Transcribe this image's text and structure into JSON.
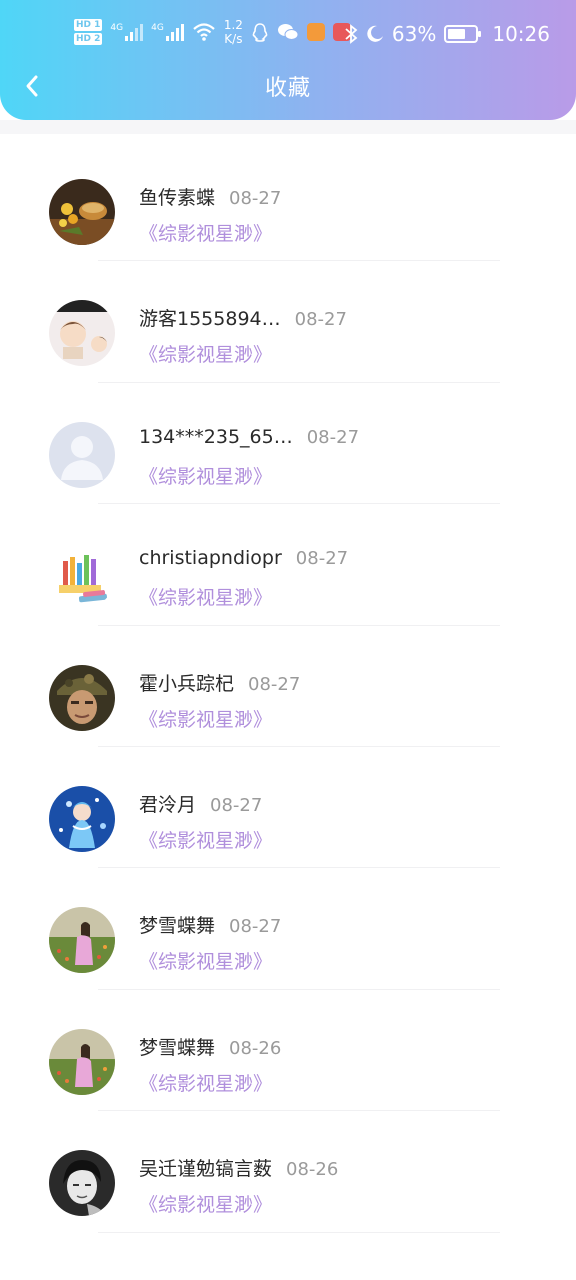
{
  "status_bar": {
    "hd1": "HD",
    "hd1_num": "1",
    "hd2": "HD",
    "hd2_num": "2",
    "net1": "4G",
    "net2": "4G",
    "speed_value": "1.2",
    "speed_unit": "K/s",
    "battery_percent": "63%",
    "battery_level": 0.63,
    "time": "10:26"
  },
  "header": {
    "title": "收藏"
  },
  "items": [
    {
      "name": "鱼传素蝶",
      "date": "08-27",
      "book": "《综影视星渺》",
      "avatar": "avatar-tea"
    },
    {
      "name": "游客1555894…",
      "date": "08-27",
      "book": "《综影视星渺》",
      "avatar": "avatar-anime-kids"
    },
    {
      "name": "134***235_65…",
      "date": "08-27",
      "book": "《综影视星渺》",
      "avatar": "avatar-default"
    },
    {
      "name": "christiapndiopr",
      "date": "08-27",
      "book": "《综影视星渺》",
      "avatar": "avatar-pencils"
    },
    {
      "name": "霍小兵踪杞",
      "date": "08-27",
      "book": "《综影视星渺》",
      "avatar": "avatar-soldier"
    },
    {
      "name": "君泠月",
      "date": "08-27",
      "book": "《综影视星渺》",
      "avatar": "avatar-blue-girl"
    },
    {
      "name": "梦雪蝶舞",
      "date": "08-27",
      "book": "《综影视星渺》",
      "avatar": "avatar-field-girl"
    },
    {
      "name": "梦雪蝶舞",
      "date": "08-26",
      "book": "《综影视星渺》",
      "avatar": "avatar-field-girl"
    },
    {
      "name": "吴迁谨勉镐言薮",
      "date": "08-26",
      "book": "《综影视星渺》",
      "avatar": "avatar-bw-portrait"
    }
  ],
  "colors": {
    "header_start": "#4fd6f7",
    "header_end": "#b99be8",
    "book_title": "#b08fdc",
    "date": "#9a9a9a"
  }
}
